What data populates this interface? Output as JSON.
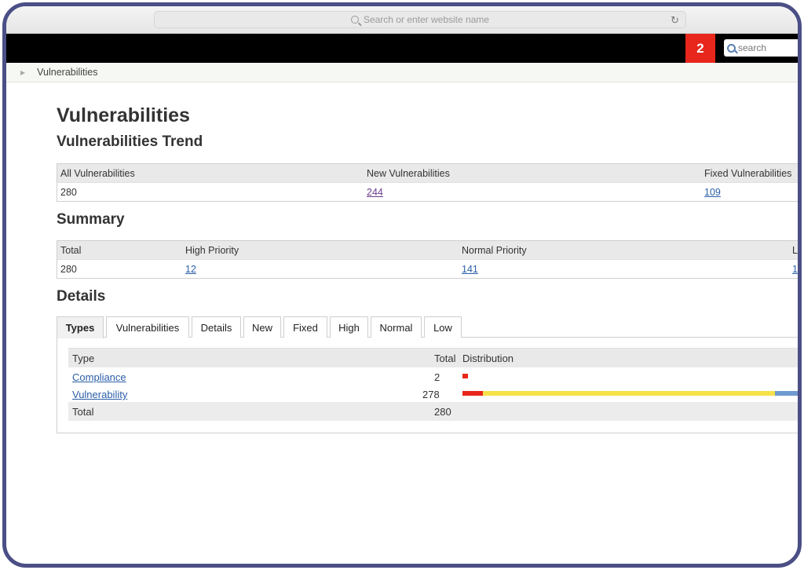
{
  "browser": {
    "url_placeholder": "Search or enter website name"
  },
  "topbar": {
    "notification_count": "2",
    "search_placeholder": "search"
  },
  "breadcrumb": {
    "current": "Vulnerabilities"
  },
  "page": {
    "title": "Vulnerabilities"
  },
  "trend": {
    "heading": "Vulnerabilities Trend",
    "headers": [
      "All Vulnerabilities",
      "New Vulnerabilities",
      "Fixed Vulnerabilities"
    ],
    "values": [
      "280",
      "244",
      "109"
    ]
  },
  "summary": {
    "heading": "Summary",
    "headers": [
      "Total",
      "High Priority",
      "Normal Priority",
      "L"
    ],
    "values": [
      "280",
      "12",
      "141",
      "1"
    ]
  },
  "details": {
    "heading": "Details",
    "tabs": [
      "Types",
      "Vulnerabilities",
      "Details",
      "New",
      "Fixed",
      "High",
      "Normal",
      "Low"
    ],
    "active_tab": "Types",
    "table": {
      "headers": [
        "Type",
        "Total",
        "Distribution"
      ],
      "rows": [
        {
          "type": "Compliance",
          "total": "2"
        },
        {
          "type": "Vulnerability",
          "total": "278"
        }
      ],
      "footer": {
        "label": "Total",
        "total": "280"
      }
    }
  },
  "colors": {
    "high": "#e8261c",
    "normal": "#f6e14a",
    "low": "#6e9ad0",
    "accent_badge": "#e8261c"
  }
}
